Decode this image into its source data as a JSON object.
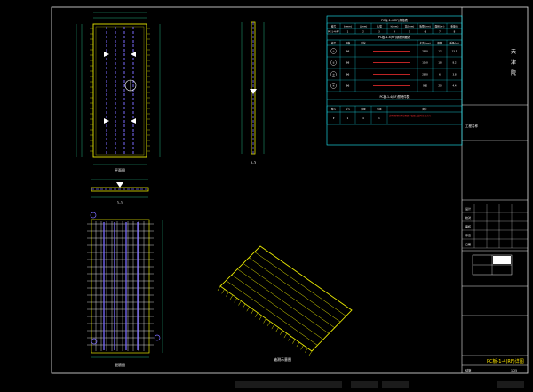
{
  "colors": {
    "background": "#000000",
    "frame": "#e8e8e8",
    "outline": "#e6e600",
    "rebar": "#ffffff",
    "prestress": "#7b6cff",
    "dimension": "#2fe0a0",
    "table_line": "#1ff0ff",
    "highlight": "#ff3030",
    "accent": "#ffe600"
  },
  "views": {
    "plan_label": "平面图",
    "section_22_label": "2-2",
    "section_11_label": "1-1",
    "rebar_label": "配筋图",
    "iso_label": "轴测示意图"
  },
  "table": {
    "title": "PC板-1-4(RF)规格表",
    "header": [
      "编号",
      "b(mm)",
      "L(mm)",
      "长/宽",
      "h(mm)",
      "宽/(mm)",
      "板厚(mm)",
      "面积(m²)",
      "重量(t)"
    ],
    "row1": [
      "PC-1-4-RF",
      "1",
      "2",
      "3",
      "4",
      "5",
      "6",
      "7",
      "8"
    ],
    "sub1_title": "PC板-1-4(RF)钢筋明细表",
    "sub1_header": [
      "编号",
      "规格",
      "形状",
      "",
      "",
      "",
      "长度(mm)",
      "根数",
      "重量(kg)"
    ],
    "sub1_rows": [
      {
        "no": "①",
        "spec": "Φ8",
        "len": "2850",
        "qty": "12",
        "wt": "13.5"
      },
      {
        "no": "②",
        "spec": "Φ8",
        "len": "1160",
        "qty": "18",
        "wt": "8.2"
      },
      {
        "no": "③",
        "spec": "Φ6",
        "len": "2850",
        "qty": "6",
        "wt": "3.8"
      },
      {
        "no": "④",
        "spec": "Φ6",
        "len": "980",
        "qty": "20",
        "wt": "4.4"
      }
    ],
    "sub2_title": "PC板-1-4(RF)预埋件表",
    "sub2_header": [
      "编号",
      "型号",
      "数量",
      "位置",
      "备注"
    ],
    "sub2_row": [
      "P",
      "1",
      "4",
      "1",
      "说明:预埋吊件位置见平面图,安装时注意方向"
    ]
  },
  "title_block": {
    "company": "天津院",
    "logo_text": "天\n津\n院",
    "project_label": "工程名称",
    "drawing_title": "PC板-1-4(RF)详图",
    "sheet_no": "结施",
    "rows": [
      "设计",
      "校对",
      "审核",
      "审定",
      "日期"
    ],
    "scale": "1:25"
  },
  "taskbar": {
    "items": [
      "",
      "",
      "",
      "",
      ""
    ]
  }
}
